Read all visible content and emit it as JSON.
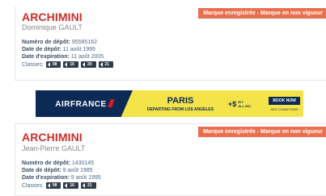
{
  "results": [
    {
      "brand": "ARCHIMINI",
      "owner": "Dominique GAULT",
      "status": "Marque enregistrée - Marque en non vigueur",
      "deposit_number_label": "Numéro de dépôt:",
      "deposit_number": " 95585162",
      "deposit_date_label": "Date de dépôt:",
      "deposit_date": " 11 août 1995",
      "expiration_label": "Date d'expiration:",
      "expiration_date": " 11 août 2005",
      "classes_label": "Classes:",
      "classes": [
        "08",
        "16",
        "20",
        "21"
      ]
    },
    {
      "brand": "ARCHIMINI",
      "owner": "Jean-Pierre GAULT",
      "status": "Marque enregistrée - Marque en non vigueur",
      "deposit_number_label": "Numéro de dépôt:",
      "deposit_number": " 1430145",
      "deposit_date_label": "Date de dépôt:",
      "deposit_date": " 9 août 1985",
      "expiration_label": "Date d'expiration:",
      "expiration_date": " 9 août 1995",
      "classes_label": "Classes:",
      "classes": [
        "08",
        "16",
        "21"
      ]
    }
  ],
  "ad": {
    "logo": "AIRFRANCE",
    "city": "PARIS",
    "subtitle": "DEPARTING FROM LOS ANGELES",
    "price": "+$",
    "price_note_1": "R/T",
    "price_note_2": "ALL INC.",
    "button": "BOOK NOW",
    "conditions": "SEE CONDITIONS"
  },
  "colors": {
    "brand": "#c9302c",
    "ribbon": "#e9704f",
    "chip": "#2f3d4a",
    "ad_bg": "#f4e44a",
    "ad_navy": "#0b2a55"
  }
}
